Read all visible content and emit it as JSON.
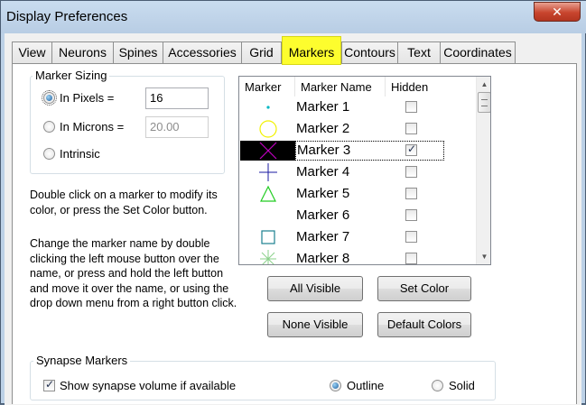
{
  "window": {
    "title": "Display Preferences",
    "close_glyph": "✕"
  },
  "tabs": [
    {
      "label": "View",
      "active": false
    },
    {
      "label": "Neurons",
      "active": false
    },
    {
      "label": "Spines",
      "active": false
    },
    {
      "label": "Accessories",
      "active": false
    },
    {
      "label": "Grid",
      "active": false
    },
    {
      "label": "Markers",
      "active": true
    },
    {
      "label": "Contours",
      "active": false
    },
    {
      "label": "Text",
      "active": false
    },
    {
      "label": "Coordinates",
      "active": false
    }
  ],
  "marker_sizing": {
    "title": "Marker Sizing",
    "pixels_label": "In Pixels =",
    "pixels_value": "16",
    "microns_label": "In Microns =",
    "microns_value": "20.00",
    "intrinsic_label": "Intrinsic",
    "selected": "pixels"
  },
  "help": {
    "text1": "Double click on a marker to modify its color, or press the Set Color button.",
    "text2": "Change the marker name by double clicking the left mouse button over the name, or press and hold the left button and move it over the name, or using the drop down menu from a right button click."
  },
  "marker_list": {
    "columns": [
      "Marker",
      "Marker Name",
      "Hidden"
    ],
    "rows": [
      {
        "name": "Marker 1",
        "hidden": false,
        "icon": "dot-icon",
        "color": "#00b7c3"
      },
      {
        "name": "Marker 2",
        "hidden": false,
        "icon": "circle-icon",
        "color": "#f2f200"
      },
      {
        "name": "Marker 3",
        "hidden": true,
        "icon": "x-icon",
        "color": "#c000c0",
        "selected": true
      },
      {
        "name": "Marker 4",
        "hidden": false,
        "icon": "plus-icon",
        "color": "#1a1aa0"
      },
      {
        "name": "Marker 5",
        "hidden": false,
        "icon": "triangle-icon",
        "color": "#22cc22"
      },
      {
        "name": "Marker 6",
        "hidden": false,
        "icon": "blank-icon",
        "color": "#ffffff"
      },
      {
        "name": "Marker 7",
        "hidden": false,
        "icon": "square-icon",
        "color": "#1a8090"
      },
      {
        "name": "Marker 8",
        "hidden": false,
        "icon": "star-icon",
        "color": "#8ad08a"
      }
    ]
  },
  "buttons": {
    "all_visible": "All Visible",
    "set_color": "Set Color",
    "none_visible": "None Visible",
    "default_colors": "Default Colors"
  },
  "synapse": {
    "title": "Synapse Markers",
    "show_label": "Show synapse volume if available",
    "show_checked": true,
    "outline_label": "Outline",
    "solid_label": "Solid",
    "selected": "outline"
  },
  "colors": {
    "highlight": "#fdfd2e",
    "window_frame": "#bcd1e7"
  }
}
